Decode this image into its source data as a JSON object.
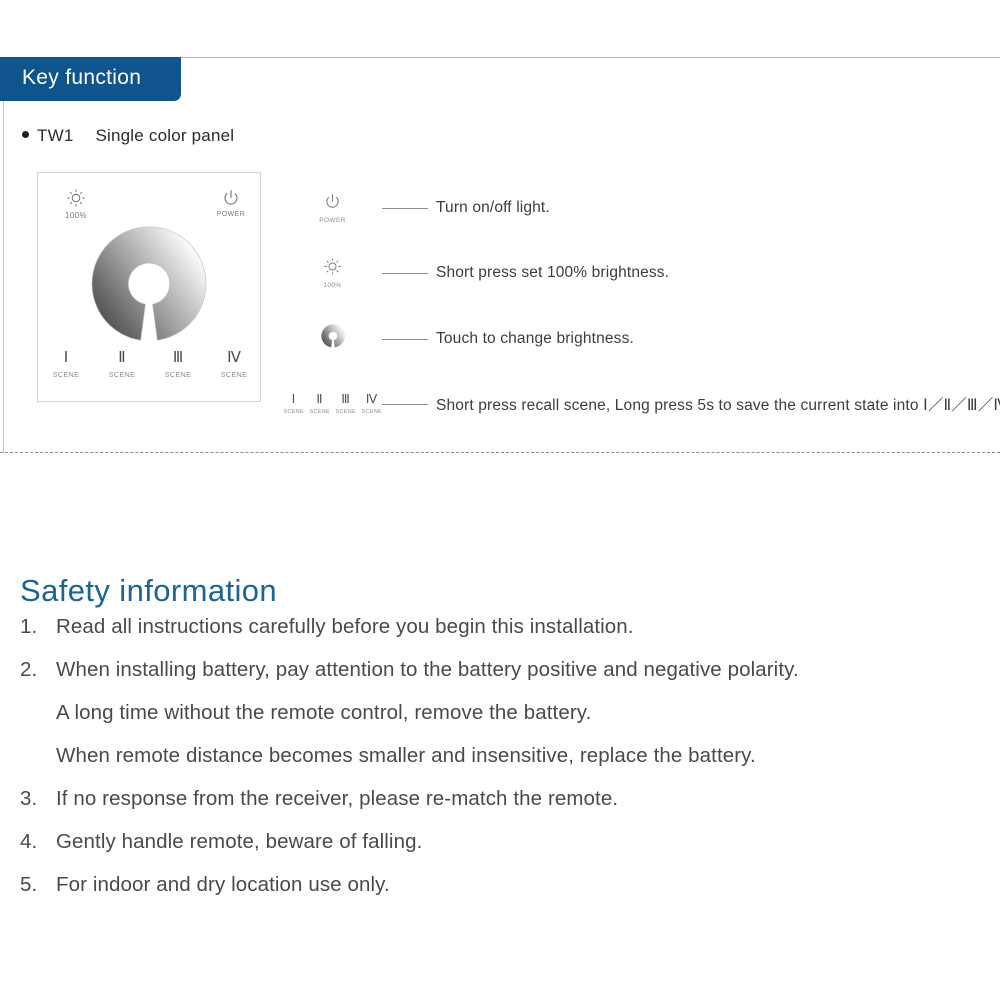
{
  "section": {
    "tab_label": "Key function",
    "model_bullet_label": "TW1",
    "model_description": "Single color panel"
  },
  "panel": {
    "brightness_icon_name": "brightness-sun-icon",
    "brightness_label": "100%",
    "power_icon_name": "power-icon",
    "power_label": "POWER",
    "ring_icon_name": "dimmer-ring",
    "scenes": [
      {
        "numeral": "Ⅰ",
        "sub": "SCENE"
      },
      {
        "numeral": "Ⅱ",
        "sub": "SCENE"
      },
      {
        "numeral": "Ⅲ",
        "sub": "SCENE"
      },
      {
        "numeral": "Ⅳ",
        "sub": "SCENE"
      }
    ]
  },
  "legend": {
    "rows": [
      {
        "icon": "power-icon",
        "icon_label": "POWER",
        "text": "Turn on/off light."
      },
      {
        "icon": "brightness-sun-icon",
        "icon_label": "100%",
        "text": "Short press set 100% brightness."
      },
      {
        "icon": "dimmer-ring-icon",
        "icon_label": "",
        "text": "Touch to change brightness."
      },
      {
        "icon": "scene-keys-icon",
        "icon_label": "",
        "text_part1": "Short press recall scene, Long press 5s to save the current state into ",
        "text_roman": "Ⅰ／Ⅱ／Ⅲ／Ⅳ",
        "text_part2": "."
      }
    ],
    "mini_scenes": [
      {
        "numeral": "Ⅰ",
        "sub": "SCENE"
      },
      {
        "numeral": "Ⅱ",
        "sub": "SCENE"
      },
      {
        "numeral": "Ⅲ",
        "sub": "SCENE"
      },
      {
        "numeral": "Ⅳ",
        "sub": "SCENE"
      }
    ]
  },
  "safety": {
    "title": "Safety information",
    "items": [
      {
        "num": "1.",
        "text": "Read all instructions carefully before you begin this installation.",
        "continuation": false
      },
      {
        "num": "2.",
        "text": "When installing battery, pay attention to the battery positive and negative polarity.",
        "continuation": false
      },
      {
        "num": "",
        "text": "A long time without the remote control, remove the battery.",
        "continuation": true
      },
      {
        "num": "",
        "text": "When remote distance becomes smaller and insensitive, replace the battery.",
        "continuation": true
      },
      {
        "num": "3.",
        "text": "If no response from the receiver, please re-match the remote.",
        "continuation": false
      },
      {
        "num": "4.",
        "text": "Gently handle remote, beware of falling.",
        "continuation": false
      },
      {
        "num": "5.",
        "text": "For indoor and dry location use only.",
        "continuation": false
      }
    ]
  },
  "colors": {
    "tab_blue": "#10548e",
    "heading_blue": "#1a6496",
    "body_gray": "#4a4a4a",
    "rule_gray": "#b9b9b9"
  }
}
